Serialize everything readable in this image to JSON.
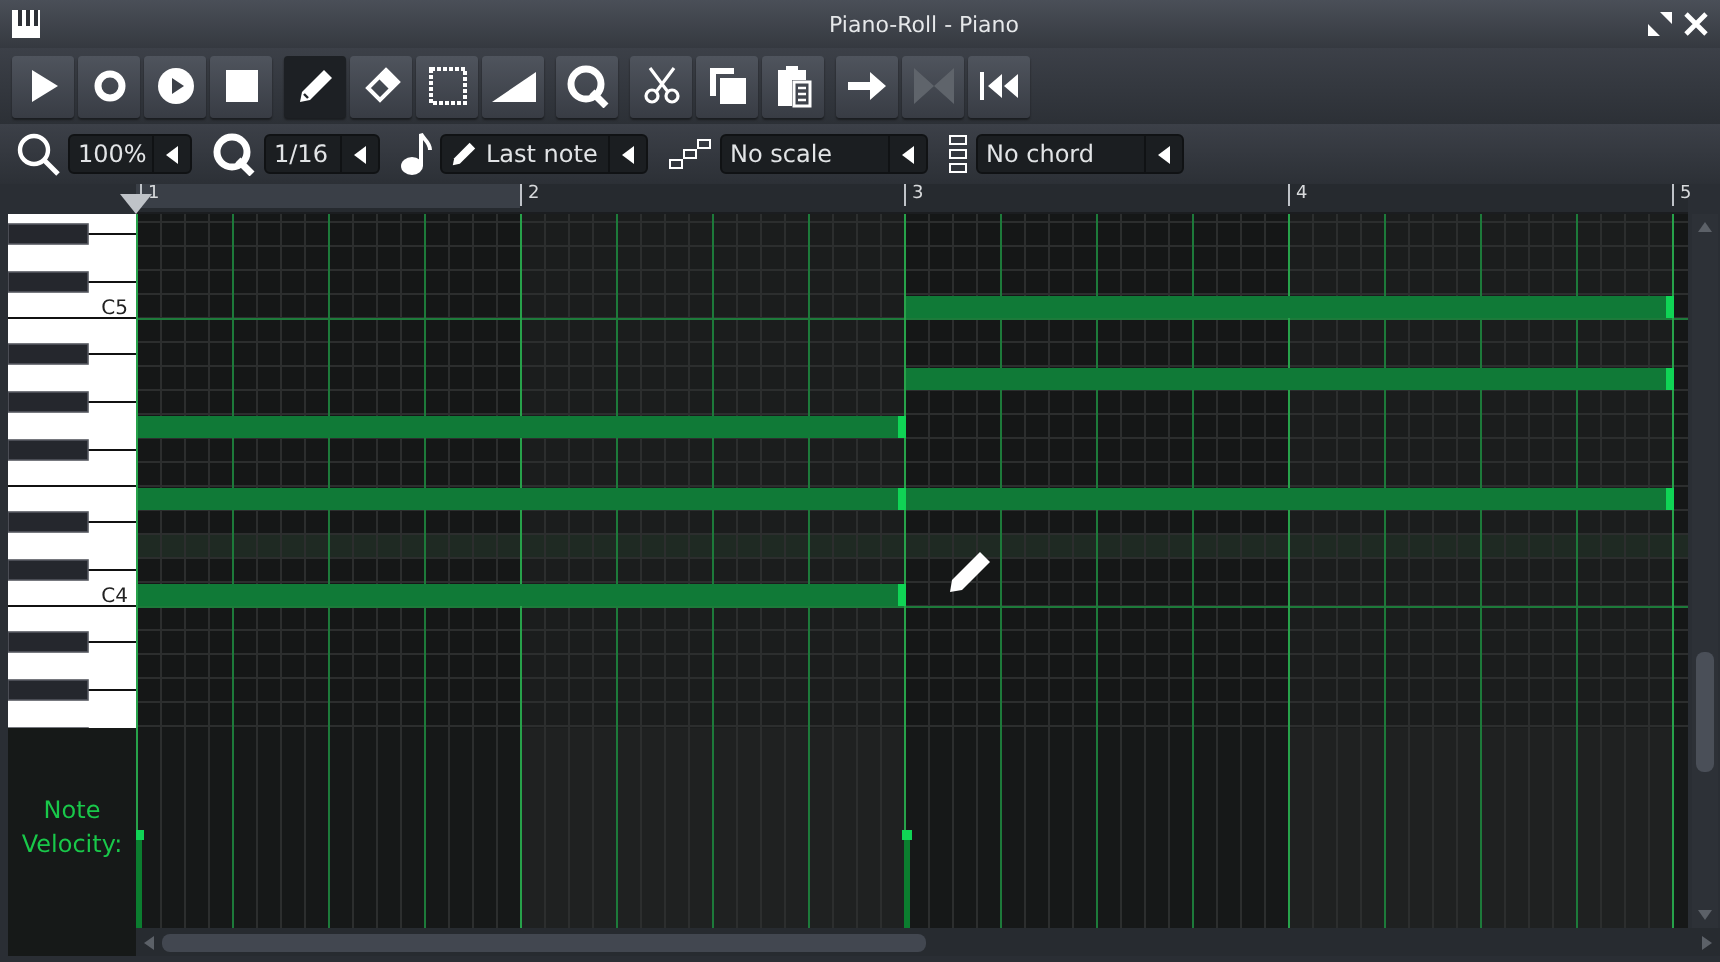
{
  "window": {
    "title": "Piano-Roll - Piano"
  },
  "toolbar_groups": [
    {
      "buttons": [
        {
          "kind": "play",
          "selected": false,
          "disabled": false
        },
        {
          "kind": "record",
          "selected": false,
          "disabled": false
        },
        {
          "kind": "record_play",
          "selected": false,
          "disabled": false
        },
        {
          "kind": "stop",
          "selected": false,
          "disabled": false
        }
      ]
    },
    {
      "buttons": [
        {
          "kind": "draw",
          "selected": true,
          "disabled": false
        },
        {
          "kind": "erase",
          "selected": false,
          "disabled": false
        },
        {
          "kind": "select",
          "selected": false,
          "disabled": false
        },
        {
          "kind": "detune",
          "selected": false,
          "disabled": false
        }
      ]
    },
    {
      "buttons": [
        {
          "kind": "quantize",
          "selected": false,
          "disabled": false
        }
      ]
    },
    {
      "buttons": [
        {
          "kind": "cut",
          "selected": false,
          "disabled": false
        },
        {
          "kind": "copy",
          "selected": false,
          "disabled": false
        },
        {
          "kind": "paste",
          "selected": false,
          "disabled": false
        }
      ]
    },
    {
      "buttons": [
        {
          "kind": "arrow",
          "selected": false,
          "disabled": false
        },
        {
          "kind": "bowtie",
          "selected": false,
          "disabled": true
        },
        {
          "kind": "rewind",
          "selected": false,
          "disabled": false
        }
      ]
    }
  ],
  "controls": [
    {
      "kind": "zoom",
      "value": "100%"
    },
    {
      "kind": "quantize",
      "value": "1/16"
    },
    {
      "kind": "note_length",
      "value": "Last note"
    },
    {
      "kind": "scale",
      "value": "No scale"
    },
    {
      "kind": "chord",
      "value": "No chord"
    }
  ],
  "ruler": {
    "bars": [
      "1",
      "2",
      "3",
      "4",
      "5"
    ]
  },
  "keyboard": {
    "labels": [
      "C5",
      "C4"
    ]
  },
  "velocity_label": "Note Velocity:"
}
